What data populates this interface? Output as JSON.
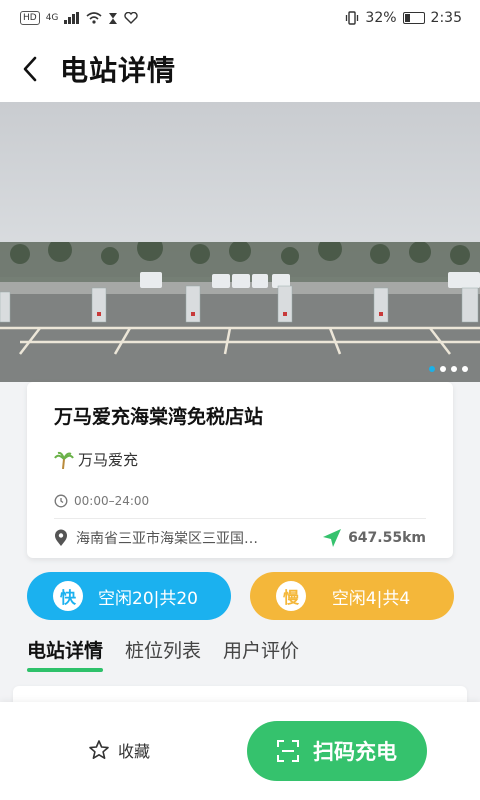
{
  "status_bar": {
    "time": "2:35",
    "battery": "32%",
    "battery_level": 0.32,
    "hd_chip": "HD",
    "network": "4G"
  },
  "header": {
    "title": "电站详情"
  },
  "carousel": {
    "page_count": 4,
    "active_index": 0
  },
  "station": {
    "name": "万马爱充海棠湾免税店站",
    "brand": "万马爱充",
    "hours": "00:00–24:00",
    "address": "海南省三亚市海棠区三亚国…",
    "distance": "647.55km"
  },
  "chargers": {
    "fast": {
      "badge": "快",
      "text": "空闲20|共20",
      "color": "#1bb1ef"
    },
    "slow": {
      "badge": "慢",
      "text": "空闲4|共4",
      "color": "#f4b73a"
    }
  },
  "tabs": [
    {
      "label": "电站详情",
      "active": true
    },
    {
      "label": "桩位列表",
      "active": false
    },
    {
      "label": "用户评价",
      "active": false
    }
  ],
  "bottom": {
    "favorite_label": "收藏",
    "scan_label": "扫码充电"
  },
  "colors": {
    "accent_green": "#35c26d",
    "fast_blue": "#1bb1ef",
    "slow_yellow": "#f4b73a"
  }
}
